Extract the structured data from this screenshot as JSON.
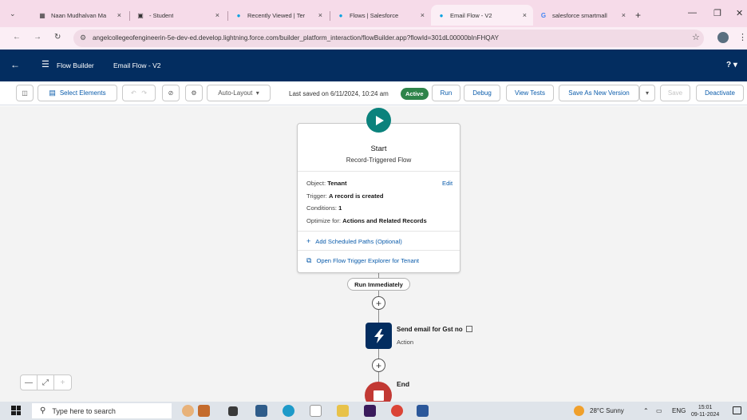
{
  "browser": {
    "tabs": [
      {
        "title": "Naan Mudhalvan Ma",
        "icon": "document-icon",
        "active": false
      },
      {
        "title": "- Student",
        "icon": "student-icon",
        "active": false
      },
      {
        "title": "Recently Viewed | Ter",
        "icon": "salesforce-cloud-icon",
        "active": false
      },
      {
        "title": "Flows | Salesforce",
        "icon": "salesforce-cloud-icon",
        "active": false
      },
      {
        "title": "Email Flow - V2",
        "icon": "salesforce-cloud-icon",
        "active": true
      },
      {
        "title": "salesforce smartmall",
        "icon": "google-icon",
        "active": false
      }
    ],
    "url": "angelcollegeofengineerin-5e-dev-ed.develop.lightning.force.com/builder_platform_interaction/flowBuilder.app?flowId=301dL00000bInFHQAY"
  },
  "header": {
    "app_name": "Flow Builder",
    "flow_name": "Email Flow - V2",
    "help": "?"
  },
  "toolbar": {
    "select_elements": "Select Elements",
    "layout": "Auto-Layout",
    "last_saved": "Last saved on 6/11/2024, 10:24 am",
    "status": "Active",
    "run": "Run",
    "debug": "Debug",
    "view_tests": "View Tests",
    "save_as_new_version": "Save As New Version",
    "save": "Save",
    "deactivate": "Deactivate"
  },
  "canvas": {
    "start": {
      "title": "Start",
      "subtitle": "Record-Triggered Flow",
      "edit": "Edit",
      "object_label": "Object:",
      "object_value": "Tenant",
      "trigger_label": "Trigger:",
      "trigger_value": "A record is created",
      "conditions_label": "Conditions:",
      "conditions_value": "1",
      "optimize_label": "Optimize for:",
      "optimize_value": "Actions and Related Records",
      "add_paths": "Add Scheduled Paths (Optional)",
      "open_explorer": "Open Flow Trigger Explorer for Tenant"
    },
    "run_immediately": "Run Immediately",
    "action": {
      "label": "Send email for Gst no",
      "type": "Action"
    },
    "end": "End"
  },
  "taskbar": {
    "search_placeholder": "Type here to search",
    "weather": "28°C Sunny",
    "language": "ENG",
    "time": "15:01",
    "date": "09-11-2024"
  }
}
